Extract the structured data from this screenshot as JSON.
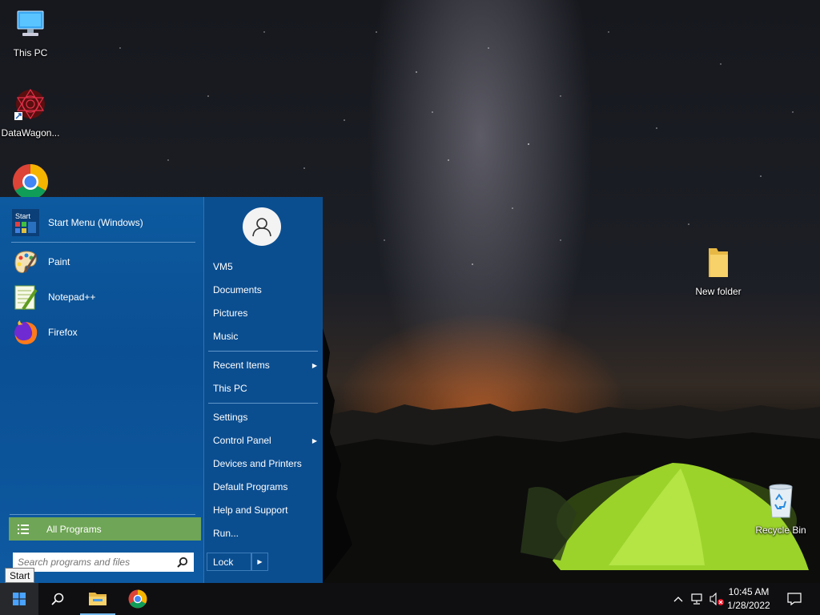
{
  "desktop": {
    "icons": [
      {
        "label": "This PC",
        "icon": "this-pc-icon"
      },
      {
        "label": "DataWagon...",
        "icon": "datawagon-icon"
      },
      {
        "label": "",
        "icon": "chrome-icon"
      },
      {
        "label": "New folder",
        "icon": "folder-icon"
      },
      {
        "label": "Recycle Bin",
        "icon": "recycle-bin-icon"
      }
    ]
  },
  "start_menu": {
    "pinned": [
      {
        "label": "Start Menu (Windows)",
        "icon": "start-menu-app-icon"
      }
    ],
    "programs": [
      {
        "label": "Paint",
        "icon": "paint-icon"
      },
      {
        "label": "Notepad++",
        "icon": "notepad-plus-plus-icon"
      },
      {
        "label": "Firefox",
        "icon": "firefox-icon"
      }
    ],
    "all_programs_label": "All Programs",
    "search_placeholder": "Search programs and files",
    "right_items": [
      {
        "label": "VM5"
      },
      {
        "label": "Documents"
      },
      {
        "label": "Pictures"
      },
      {
        "label": "Music"
      },
      {
        "label": "Recent Items",
        "submenu": true
      },
      {
        "label": "This PC"
      },
      {
        "label": "Settings"
      },
      {
        "label": "Control Panel",
        "submenu": true
      },
      {
        "label": "Devices and Printers"
      },
      {
        "label": "Default Programs"
      },
      {
        "label": "Help and Support"
      },
      {
        "label": "Run..."
      }
    ],
    "lock_label": "Lock",
    "submenu_arrow": "▶"
  },
  "tooltip": "Start",
  "taskbar": {
    "buttons": [
      "windows-start-icon",
      "search-icon",
      "file-explorer-icon",
      "chrome-icon"
    ],
    "clock_time": "10:45 AM",
    "clock_date": "1/28/2022"
  },
  "colors": {
    "start_menu_bg": "#0d5aa0",
    "all_programs_bg": "#6fa556",
    "taskbar_bg": "#0f0f12"
  }
}
